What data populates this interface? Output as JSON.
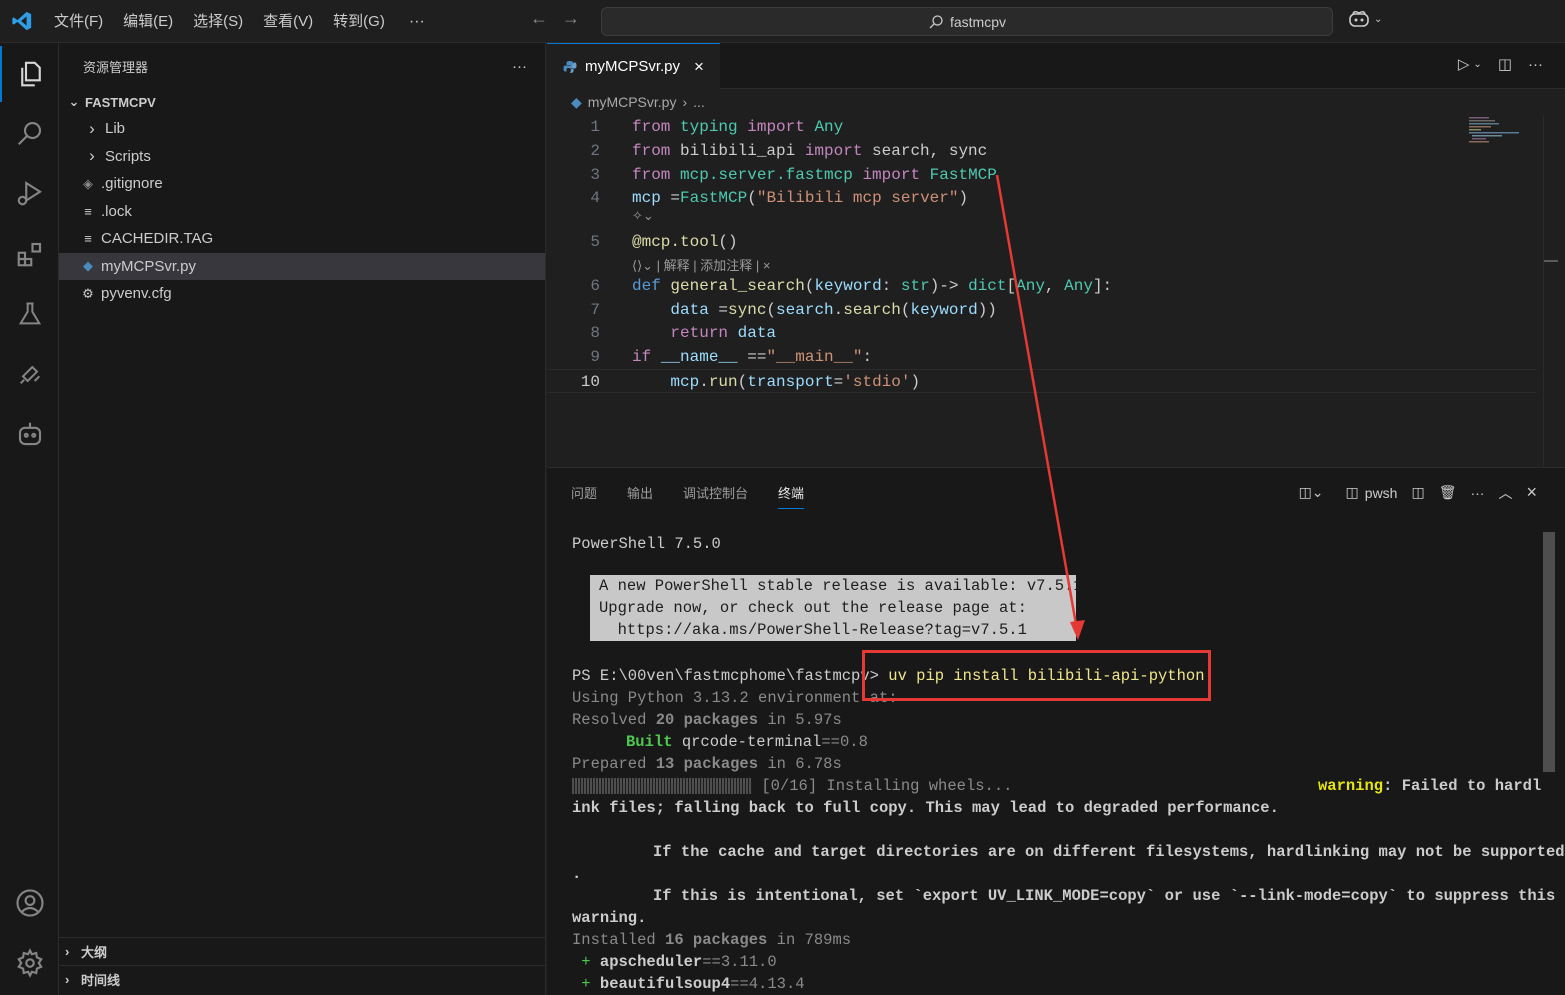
{
  "titlebar": {
    "menus": [
      "文件(F)",
      "编辑(E)",
      "选择(S)",
      "查看(V)",
      "转到(G)"
    ],
    "more": "···",
    "search_text": "fastmcpv"
  },
  "activity": [
    "explorer-icon",
    "search-icon",
    "run-debug-icon",
    "extensions-icon",
    "testing-icon",
    "remote-icon",
    "copilot-icon",
    "account-icon",
    "settings-icon"
  ],
  "sidebar": {
    "title": "资源管理器",
    "more": "···",
    "folder": "FASTMCPV",
    "items": [
      {
        "label": "Lib",
        "type": "folder"
      },
      {
        "label": "Scripts",
        "type": "folder"
      },
      {
        "label": ".gitignore",
        "type": "git"
      },
      {
        "label": ".lock",
        "type": "text"
      },
      {
        "label": "CACHEDIR.TAG",
        "type": "text"
      },
      {
        "label": "myMCPSvr.py",
        "type": "python"
      },
      {
        "label": "pyvenv.cfg",
        "type": "gear"
      }
    ],
    "outline": "大纲",
    "timeline": "时间线"
  },
  "editor": {
    "tab": "myMCPSvr.py",
    "breadcrumb_file": "myMCPSvr.py",
    "breadcrumb_more": "...",
    "lines": [
      {
        "n": "1",
        "parts": [
          [
            "kw",
            "from"
          ],
          [
            "",
            " "
          ],
          [
            "mod",
            "typing"
          ],
          [
            "",
            " "
          ],
          [
            "kw",
            "import"
          ],
          [
            "",
            " "
          ],
          [
            "mod",
            "Any"
          ]
        ]
      },
      {
        "n": "2",
        "parts": [
          [
            "kw",
            "from"
          ],
          [
            "",
            " bilibili_api "
          ],
          [
            "kw",
            "import"
          ],
          [
            "",
            " search, sync"
          ]
        ]
      },
      {
        "n": "3",
        "parts": [
          [
            "kw",
            "from"
          ],
          [
            "",
            " "
          ],
          [
            "mod",
            "mcp.server.fastmcp"
          ],
          [
            "",
            " "
          ],
          [
            "kw",
            "import"
          ],
          [
            "",
            " "
          ],
          [
            "mod",
            "FastMCP"
          ]
        ]
      },
      {
        "n": "4",
        "parts": [
          [
            "var",
            "mcp"
          ],
          [
            "",
            " ="
          ],
          [
            "mod",
            "FastMCP"
          ],
          [
            "",
            "("
          ],
          [
            "str",
            "\"Bilibili mcp server\""
          ],
          [
            "",
            ")"
          ]
        ]
      },
      {
        "n": "5",
        "parts": [
          [
            "fn",
            "@mcp.tool"
          ],
          [
            "",
            "()"
          ]
        ]
      },
      {
        "n": "6",
        "parts": [
          [
            "kw2",
            "def"
          ],
          [
            "",
            " "
          ],
          [
            "fn",
            "general_search"
          ],
          [
            "",
            "("
          ],
          [
            "var",
            "keyword"
          ],
          [
            "",
            ": "
          ],
          [
            "mod",
            "str"
          ],
          [
            "",
            ")-> "
          ],
          [
            "mod",
            "dict"
          ],
          [
            "",
            "["
          ],
          [
            "mod",
            "Any"
          ],
          [
            "",
            ", "
          ],
          [
            "mod",
            "Any"
          ],
          [
            "",
            "]:"
          ]
        ]
      },
      {
        "n": "7",
        "parts": [
          [
            "",
            "    "
          ],
          [
            "var",
            "data"
          ],
          [
            "",
            " ="
          ],
          [
            "fn",
            "sync"
          ],
          [
            "",
            "("
          ],
          [
            "var",
            "search"
          ],
          [
            "",
            "."
          ],
          [
            "fn",
            "search"
          ],
          [
            "",
            "("
          ],
          [
            "var",
            "keyword"
          ],
          [
            "",
            "))"
          ]
        ]
      },
      {
        "n": "8",
        "parts": [
          [
            "",
            "    "
          ],
          [
            "kw",
            "return"
          ],
          [
            "",
            " "
          ],
          [
            "var",
            "data"
          ]
        ]
      },
      {
        "n": "9",
        "parts": [
          [
            "kw",
            "if"
          ],
          [
            "",
            " "
          ],
          [
            "var",
            "__name__"
          ],
          [
            "",
            " =="
          ],
          [
            "str",
            "\"__main__\""
          ],
          [
            "",
            ":"
          ]
        ]
      },
      {
        "n": "10",
        "parts": [
          [
            "",
            "    "
          ],
          [
            "var",
            "mcp"
          ],
          [
            "",
            "."
          ],
          [
            "fn",
            "run"
          ],
          [
            "",
            "("
          ],
          [
            "var",
            "transport"
          ],
          [
            "",
            "="
          ],
          [
            "str",
            "'stdio'"
          ],
          [
            "",
            ")"
          ]
        ]
      }
    ],
    "lens_text": "| 解释 | 添加注释 | ×"
  },
  "panel": {
    "tabs": [
      "问题",
      "输出",
      "调试控制台",
      "终端"
    ],
    "active_tab": "终端",
    "terminal_name": "pwsh",
    "terminal": {
      "version": "PowerShell 7.5.0",
      "notice": [
        "A new PowerShell stable release is available: v7.5.1",
        "Upgrade now, or check out the release page at:",
        "  https://aka.ms/PowerShell-Release?tag=v7.5.1"
      ],
      "prompt": "PS E:\\00ven\\fastmcphome\\fastmcpv> ",
      "command": "uv pip install bilibili-api-python",
      "using": "Using Python 3.13.2 environment at:",
      "resolved_pre": "Resolved ",
      "resolved_bold": "20 packages",
      "resolved_post": " in 5.97s",
      "built_label": "Built",
      "built_pkg": "qrcode-terminal",
      "built_ver": "==0.8",
      "prepared_pre": "Prepared ",
      "prepared_bold": "13 packages",
      "prepared_post": " in 6.78s",
      "progress": "[0/16] Installing wheels...",
      "warning_label": "warning",
      "warning_a": ": Failed to hardl",
      "warning_b": "ink files; falling back to full copy. This may lead to degraded performance.",
      "cache_a": "If the cache and target directories are on different filesystems, hardlinking may not be supported",
      "cache_b": ".",
      "intent_a": "If this is intentional, set `export UV_LINK_MODE=copy` or use `--link-mode=copy` to suppress this",
      "intent_b": "warning.",
      "installed_pre": "Installed ",
      "installed_bold": "16 packages",
      "installed_post": " in 789ms",
      "pkgs": [
        {
          "name": "apscheduler",
          "ver": "==3.11.0"
        },
        {
          "name": "beautifulsoup4",
          "ver": "==4.13.4"
        }
      ]
    }
  },
  "colors": {
    "accent": "#0078d4",
    "annotation": "#e53935"
  }
}
